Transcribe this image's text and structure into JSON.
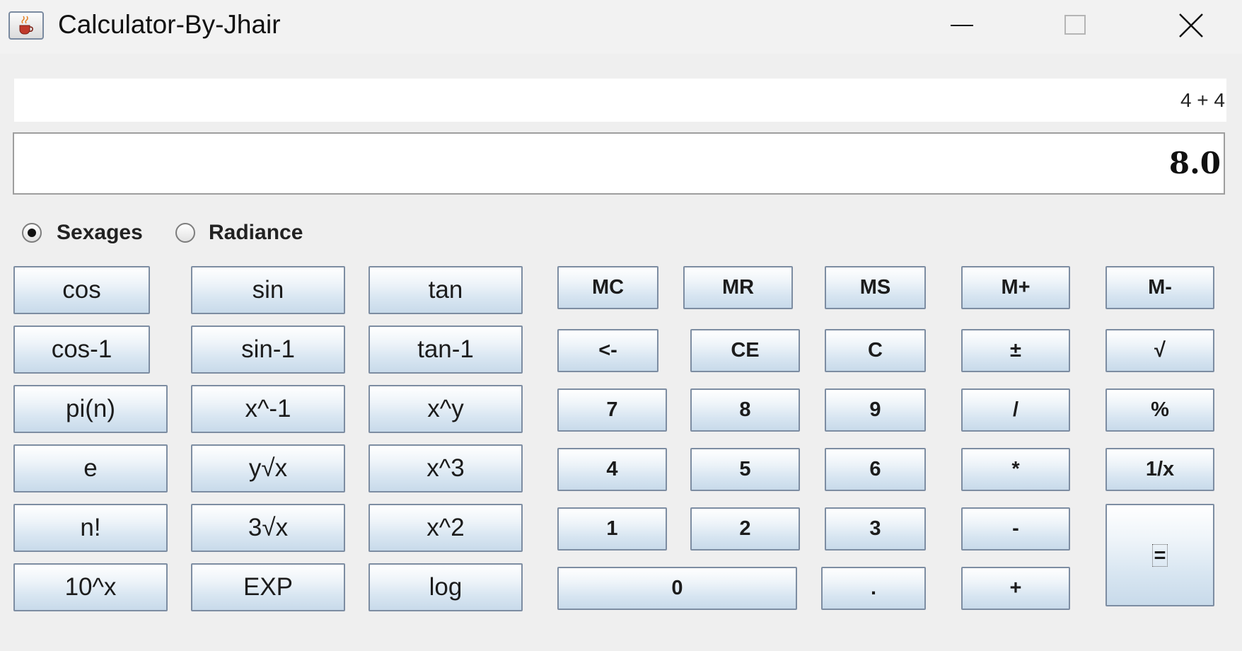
{
  "window": {
    "title": "Calculator-By-Jhair",
    "icons": {
      "app": "java-coffee-cup-icon",
      "minimize": "minimize-icon",
      "maximize": "maximize-icon",
      "close": "close-icon"
    }
  },
  "display": {
    "expression": "4 + 4",
    "result": "8.0"
  },
  "angle_mode": {
    "options": [
      "Sexages",
      "Radiance"
    ],
    "selected": "Sexages"
  },
  "scientific_buttons": [
    [
      "cos",
      "sin",
      "tan"
    ],
    [
      "cos-1",
      "sin-1",
      "tan-1"
    ],
    [
      "pi(n)",
      "x^-1",
      "x^y"
    ],
    [
      "e",
      "y√x",
      "x^3"
    ],
    [
      "n!",
      "3√x",
      "x^2"
    ],
    [
      "10^x",
      "EXP",
      "log"
    ]
  ],
  "standard_buttons": [
    [
      "MC",
      "MR",
      "MS",
      "M+",
      "M-"
    ],
    [
      "<-",
      "CE",
      "C",
      "±",
      "√"
    ],
    [
      "7",
      "8",
      "9",
      "/",
      "%"
    ],
    [
      "4",
      "5",
      "6",
      "*",
      "1/x"
    ],
    [
      "1",
      "2",
      "3",
      "-",
      "="
    ],
    [
      "0",
      ".",
      "+"
    ]
  ],
  "colors": {
    "window_bg": "#efefef",
    "button_border": "#7d8da2",
    "button_gradient_top": "#ffffff",
    "button_gradient_bottom": "#c8daea"
  }
}
